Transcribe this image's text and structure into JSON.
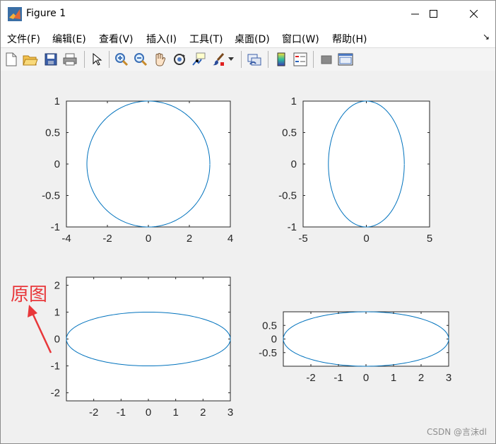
{
  "window": {
    "title": "Figure 1"
  },
  "menu": [
    "文件(F)",
    "编辑(E)",
    "查看(V)",
    "插入(I)",
    "工具(T)",
    "桌面(D)",
    "窗口(W)",
    "帮助(H)"
  ],
  "toolbar_icons": [
    "new-figure-icon",
    "open-file-icon",
    "save-icon",
    "print-icon",
    "select-arrow-icon",
    "zoom-in-icon",
    "zoom-out-icon",
    "pan-hand-icon",
    "rotate-3d-icon",
    "data-cursor-icon",
    "brush-icon",
    "brush-dropdown-icon",
    "link-plot-icon",
    "colorbar-icon",
    "legend-icon",
    "hide-plot-tools-icon",
    "show-plot-tools-icon"
  ],
  "plot_color": "#0072bd",
  "annotation": {
    "text": "原图",
    "color": "#e8373a"
  },
  "watermark": "CSDN @言沫dl",
  "chart_data": [
    {
      "type": "line",
      "series": [
        {
          "x_formula": "3*cos(t)",
          "y_formula": "sin(t)",
          "t": [
            0,
            6.28
          ]
        }
      ],
      "xlim": [
        -4,
        4
      ],
      "ylim": [
        -1,
        1
      ],
      "xticks": [
        "-4",
        "-2",
        "0",
        "2",
        "4"
      ],
      "yticks": [
        "-1",
        "-0.5",
        "0",
        "0.5",
        "1"
      ]
    },
    {
      "type": "line",
      "series": [
        {
          "x_formula": "3*cos(t)",
          "y_formula": "sin(t)",
          "t": [
            0,
            6.28
          ]
        }
      ],
      "xlim": [
        -5,
        5
      ],
      "ylim": [
        -1,
        1
      ],
      "xticks": [
        "-5",
        "0",
        "5"
      ],
      "yticks": [
        "-1",
        "-0.5",
        "0",
        "0.5",
        "1"
      ]
    },
    {
      "type": "line",
      "series": [
        {
          "x_formula": "3*cos(t)",
          "y_formula": "sin(t)",
          "t": [
            0,
            6.28
          ]
        }
      ],
      "xlim": [
        -3,
        3
      ],
      "ylim": [
        -2.3,
        2.3
      ],
      "xticks": [
        "-2",
        "-1",
        "0",
        "1",
        "2",
        "3"
      ],
      "yticks": [
        "-2",
        "-1",
        "0",
        "1",
        "2"
      ]
    },
    {
      "type": "line",
      "series": [
        {
          "x_formula": "3*cos(t)",
          "y_formula": "sin(t)",
          "t": [
            0,
            6.28
          ]
        }
      ],
      "xlim": [
        -3,
        3
      ],
      "ylim": [
        -1,
        1
      ],
      "xticks": [
        "-2",
        "-1",
        "0",
        "1",
        "2",
        "3"
      ],
      "yticks": [
        "-0.5",
        "0",
        "0.5"
      ]
    }
  ]
}
